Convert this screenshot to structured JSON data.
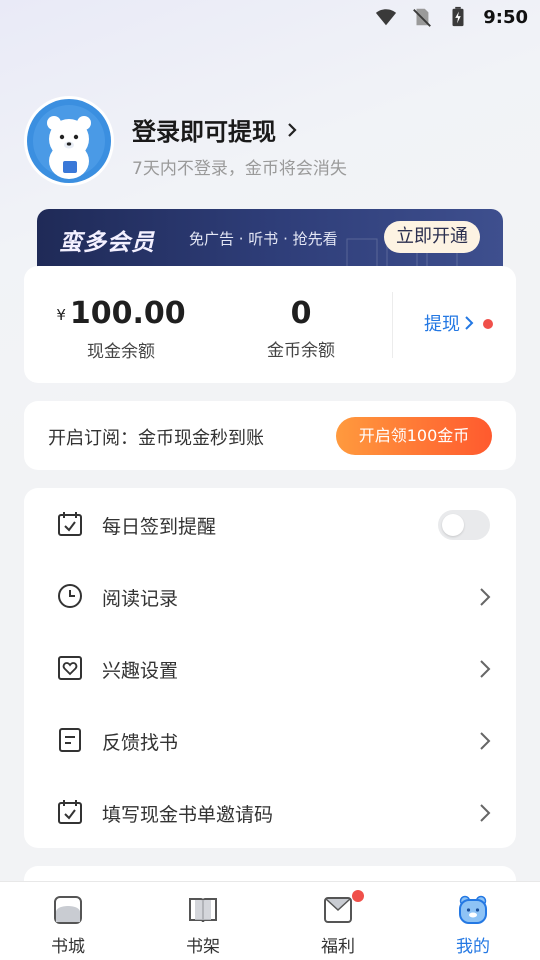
{
  "status_bar": {
    "time": "9:50",
    "icons": [
      "wifi-icon",
      "no-sim-icon",
      "battery-charging-icon"
    ]
  },
  "profile": {
    "login_title": "登录即可提现",
    "login_subtitle": "7天内不登录，金币将会消失",
    "avatar": "polar-bear-avatar"
  },
  "vip_banner": {
    "title": "蛮多会员",
    "description": "免广告 · 听书 · 抢先看",
    "button": "立即开通"
  },
  "balance": {
    "currency_symbol": "¥",
    "cash_value": "100.00",
    "cash_label": "现金余额",
    "coin_value": "0",
    "coin_label": "金币余额",
    "withdraw_label": "提现"
  },
  "subscribe": {
    "text": "开启订阅：金币现金秒到账",
    "button": "开启领100金币"
  },
  "menu": {
    "items": [
      {
        "label": "每日签到提醒",
        "icon": "calendar-check-icon",
        "control": "toggle",
        "on": false
      },
      {
        "label": "阅读记录",
        "icon": "clock-icon",
        "control": "chevron"
      },
      {
        "label": "兴趣设置",
        "icon": "heart-icon",
        "control": "chevron"
      },
      {
        "label": "反馈找书",
        "icon": "document-icon",
        "control": "chevron"
      },
      {
        "label": "填写现金书单邀请码",
        "icon": "calendar-check-icon",
        "control": "chevron"
      }
    ]
  },
  "bottom_nav": {
    "items": [
      {
        "label": "书城",
        "icon": "bookstore-icon",
        "active": false
      },
      {
        "label": "书架",
        "icon": "bookshelf-icon",
        "active": false
      },
      {
        "label": "福利",
        "icon": "welfare-envelope-icon",
        "active": false,
        "badge": true
      },
      {
        "label": "我的",
        "icon": "bear-face-icon",
        "active": true
      }
    ]
  },
  "colors": {
    "accent_blue": "#2478e3",
    "badge_red": "#f0504a",
    "cta_orange_start": "#ff9a3e",
    "cta_orange_end": "#ff5a2e",
    "vip_navy": "#1f2a57",
    "page_bg": "#f2f3f5"
  }
}
